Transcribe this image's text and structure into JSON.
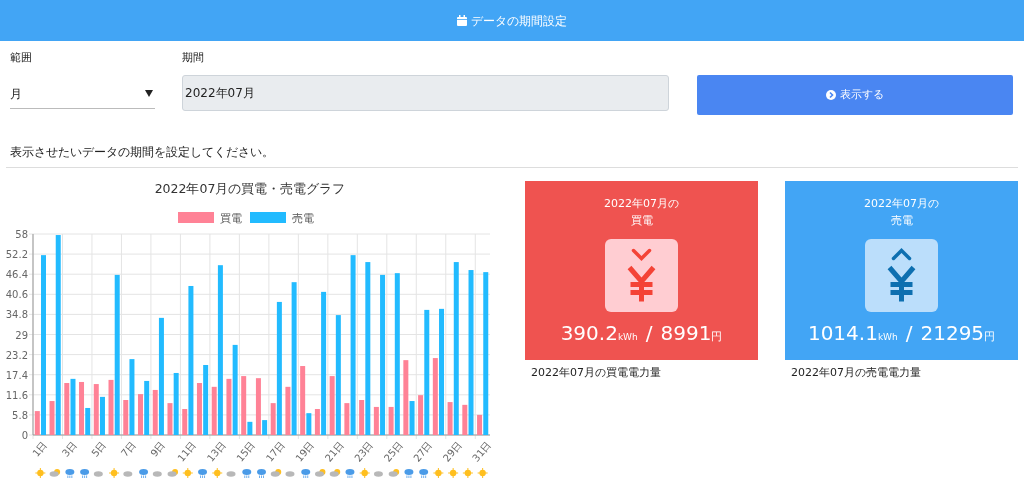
{
  "header": {
    "title": "データの期間設定"
  },
  "form": {
    "range_label": "範囲",
    "range_value": "月",
    "period_label": "期間",
    "period_value": "2022年07月",
    "submit_label": "表示する"
  },
  "help_text": "表示させたいデータの期間を設定してください。",
  "chart_data": {
    "type": "bar",
    "title": "2022年07月の買電・売電グラフ",
    "x": [
      1,
      2,
      3,
      4,
      5,
      6,
      7,
      8,
      9,
      10,
      11,
      12,
      13,
      14,
      15,
      16,
      17,
      18,
      19,
      20,
      21,
      22,
      23,
      24,
      25,
      26,
      27,
      28,
      29,
      30,
      31
    ],
    "xticks": [
      {
        "value": 1,
        "label": "1日"
      },
      {
        "value": 3,
        "label": "3日"
      },
      {
        "value": 5,
        "label": "5日"
      },
      {
        "value": 7,
        "label": "7日"
      },
      {
        "value": 9,
        "label": "9日"
      },
      {
        "value": 11,
        "label": "11日"
      },
      {
        "value": 13,
        "label": "13日"
      },
      {
        "value": 15,
        "label": "15日"
      },
      {
        "value": 17,
        "label": "17日"
      },
      {
        "value": 19,
        "label": "19日"
      },
      {
        "value": 21,
        "label": "21日"
      },
      {
        "value": 23,
        "label": "23日"
      },
      {
        "value": 25,
        "label": "25日"
      },
      {
        "value": 27,
        "label": "27日"
      },
      {
        "value": 29,
        "label": "29日"
      },
      {
        "value": 31,
        "label": "31日"
      }
    ],
    "xlim": [
      0.5,
      31.5
    ],
    "grid": true,
    "legend": true,
    "ylim": [
      0,
      58
    ],
    "yticks": [
      0,
      5.8,
      11.6,
      17.4,
      23.2,
      29,
      34.8,
      40.6,
      46.4,
      52.2,
      58
    ],
    "series": [
      {
        "name": "買電",
        "color": "#ff8296",
        "values": [
          6.9,
          9.8,
          15.0,
          15.3,
          14.7,
          15.9,
          10.1,
          11.8,
          13.0,
          9.2,
          7.5,
          15.0,
          13.9,
          16.2,
          17.0,
          16.4,
          9.2,
          13.9,
          19.9,
          7.5,
          17.0,
          9.2,
          10.1,
          8.1,
          8.1,
          21.6,
          11.5,
          22.2,
          9.5,
          8.7,
          5.8
        ]
      },
      {
        "name": "売電",
        "color": "#22bbff",
        "values": [
          51.9,
          57.7,
          16.2,
          7.8,
          11.0,
          46.2,
          21.9,
          15.6,
          33.8,
          17.9,
          43.0,
          20.2,
          49.0,
          26.0,
          3.8,
          4.3,
          38.4,
          44.1,
          6.3,
          41.3,
          34.6,
          51.9,
          49.9,
          46.2,
          46.7,
          9.8,
          36.1,
          36.4,
          49.9,
          47.6,
          47.0
        ]
      }
    ]
  },
  "cards": [
    {
      "kind": "buy",
      "title_line1": "2022年07月の",
      "title_line2": "買電",
      "total": "390.2",
      "total_unit": "kWh",
      "separator": "/",
      "amount": "8991",
      "amount_unit": "円",
      "caption": "2022年07月の買電電力量"
    },
    {
      "kind": "sell",
      "title_line1": "2022年07月の",
      "title_line2": "売電",
      "total": "1014.1",
      "total_unit": "kWh",
      "separator": "/",
      "amount": "21295",
      "amount_unit": "円",
      "caption": "2022年07月の売電電力量"
    }
  ]
}
